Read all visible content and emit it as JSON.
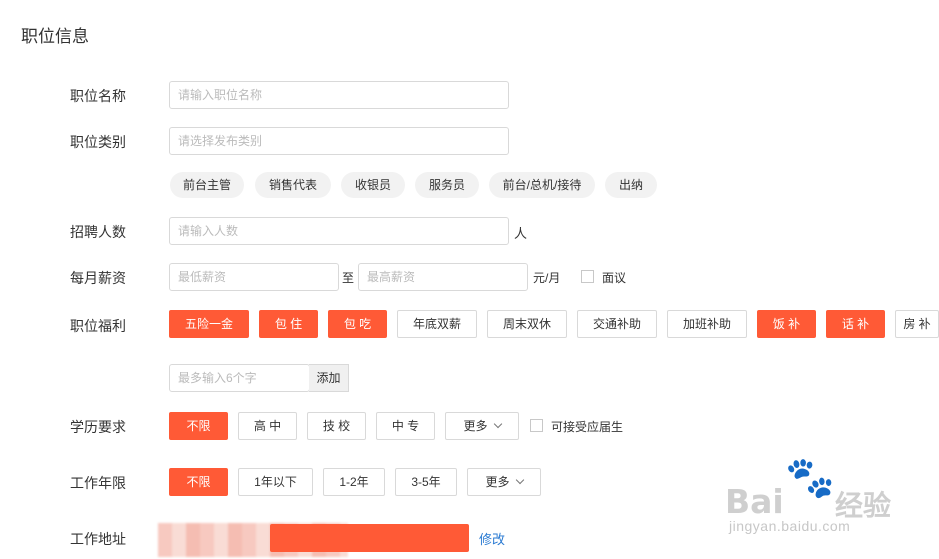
{
  "section_title": "职位信息",
  "labels": {
    "name": "职位名称",
    "category": "职位类别",
    "headcount": "招聘人数",
    "salary": "每月薪资",
    "welfare": "职位福利",
    "education": "学历要求",
    "experience": "工作年限",
    "address": "工作地址"
  },
  "inputs": {
    "name_placeholder": "请输入职位名称",
    "category_placeholder": "请选择发布类别",
    "headcount_placeholder": "请输入人数",
    "salary_min_placeholder": "最低薪资",
    "salary_max_placeholder": "最高薪资",
    "custom_welfare_placeholder": "最多输入6个字"
  },
  "category_suggestions": [
    "前台主管",
    "销售代表",
    "收银员",
    "服务员",
    "前台/总机/接待",
    "出纳"
  ],
  "headcount_unit": "人",
  "salary": {
    "to": "至",
    "unit": "元/月",
    "negotiable": "面议"
  },
  "welfare": {
    "tags": [
      "五险一金",
      "包 住",
      "包 吃",
      "年底双薪",
      "周末双休",
      "交通补助",
      "加班补助",
      "饭 补",
      "话 补",
      "房 补"
    ],
    "active": [
      true,
      true,
      true,
      false,
      false,
      false,
      false,
      true,
      true,
      false
    ],
    "add_button": "添加"
  },
  "education": {
    "options": [
      "不限",
      "高 中",
      "技 校",
      "中 专"
    ],
    "more": "更多",
    "fresh_grad": "可接受应届生"
  },
  "experience": {
    "options": [
      "不限",
      "1年以下",
      "1-2年",
      "3-5年"
    ],
    "more": "更多"
  },
  "address": {
    "edit_link": "修改"
  },
  "watermark": {
    "brand_left": "Bai",
    "brand_right": "经验",
    "url": "jingyan.baidu.com"
  },
  "colors": {
    "accent": "#ff5a36",
    "link": "#2a7ad2"
  }
}
